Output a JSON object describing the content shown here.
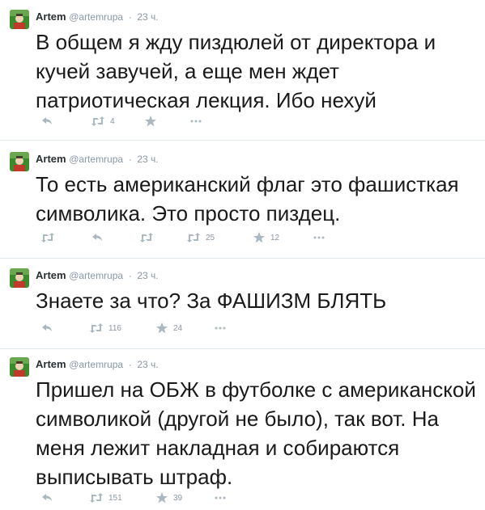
{
  "tweets": [
    {
      "name": "Artem",
      "handle": "@artemrupa",
      "separator": "·",
      "time": "23 ч.",
      "text": "В общем я жду пиздюлей от директора и кучей завучей, а еще мен ждет патриотическая лекция. Ибо нехуй",
      "retweet_count": "4"
    },
    {
      "name": "Artem",
      "handle": "@artemrupa",
      "separator": "·",
      "time": "23 ч.",
      "text": "То есть американский флаг это фашисткая символика. Это просто пиздец.",
      "retweet_count": "25",
      "favorite_count": "12"
    },
    {
      "name": "Artem",
      "handle": "@artemrupa",
      "separator": "·",
      "time": "23 ч.",
      "text": "Знаете за что? За ФАШИЗМ БЛЯТЬ",
      "retweet_count": "116",
      "favorite_count": "24"
    },
    {
      "name": "Artem",
      "handle": "@artemrupa",
      "separator": "·",
      "time": "23 ч.",
      "text": "Пришел на ОБЖ в футболке с американской символикой (другой не было), так вот. На меня лежит накладная и собираются выписывать штраф.",
      "retweet_count": "151",
      "favorite_count": "39"
    }
  ],
  "icons": {
    "reply": "reply-icon",
    "retweet": "retweet-icon",
    "favorite": "star-icon",
    "more": "more-icon"
  },
  "colors": {
    "icon_gray": "#aab8c2",
    "meta_gray": "#8899a6",
    "avatar_green": "#3c8a2e"
  }
}
